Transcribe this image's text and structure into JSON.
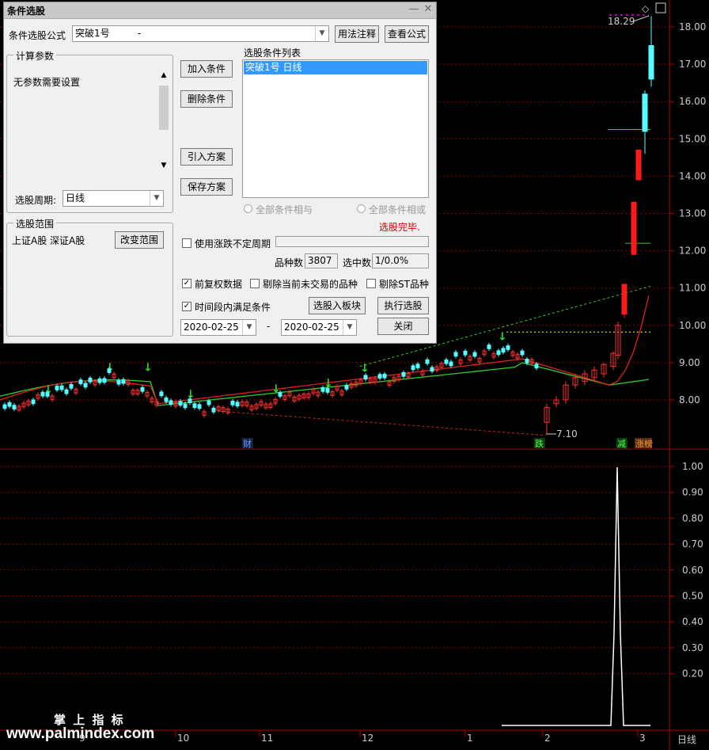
{
  "chart_data": {
    "type": "candlestick",
    "y_ticks": [
      "18.00",
      "17.00",
      "16.00",
      "15.00",
      "14.00",
      "13.00",
      "12.00",
      "11.00",
      "10.00",
      "9.00",
      "8.00"
    ],
    "sub_y_ticks": [
      "1.00",
      "0.90",
      "0.80",
      "0.70",
      "0.60",
      "0.50",
      "0.40",
      "0.30",
      "0.20"
    ],
    "x_ticks": [
      "9",
      "10",
      "11",
      "12",
      "1",
      "2",
      "3"
    ],
    "high_label": "18.29",
    "low_label": "7.10",
    "period_label": "日线",
    "event_markers": [
      {
        "text": "财",
        "color": "#3a6fd1"
      },
      {
        "text": "跌",
        "color": "#1a9a1a"
      },
      {
        "text": "减",
        "color": "#1a9a1a"
      },
      {
        "text": "涨榜",
        "color": "#d07020"
      }
    ]
  },
  "dialog": {
    "title": "条件选股",
    "formula_label": "条件选股公式",
    "formula_value": "突破1号",
    "formula_dash": "-",
    "usage_btn": "用法注释",
    "view_formula_btn": "查看公式",
    "calc_params_title": "计算参数",
    "no_params_text": "无参数需要设置",
    "period_label": "选股周期:",
    "period_value": "日线",
    "scope_title": "选股范围",
    "scope_value": "上证A股  深证A股",
    "change_scope_btn": "改变范围",
    "add_cond_btn": "加入条件",
    "del_cond_btn": "删除条件",
    "import_plan_btn": "引入方案",
    "save_plan_btn": "保存方案",
    "cond_list_title": "选股条件列表",
    "cond_list_item": "突破1号  日线",
    "radio_and": "全部条件相与",
    "radio_or": "全部条件相或",
    "status_text": "选股完毕.",
    "use_period_label": "使用涨跌不定周期",
    "count_label": "品种数",
    "count_value": "3807",
    "selected_label": "选中数",
    "selected_value": "1/0.0%",
    "fq_label": "前复权数据",
    "exclude_untraded_label": "剔除当前未交易的品种",
    "exclude_st_label": "剔除ST品种",
    "time_range_label": "时间段内满足条件",
    "to_board_btn": "选股入板块",
    "exec_btn": "执行选股",
    "close_btn": "关闭",
    "date_from": "2020-02-25",
    "date_dash": "-",
    "date_to": "2020-02-25"
  },
  "watermark": {
    "cn": "掌 上 指 标",
    "url": "www.palmindex.com"
  }
}
